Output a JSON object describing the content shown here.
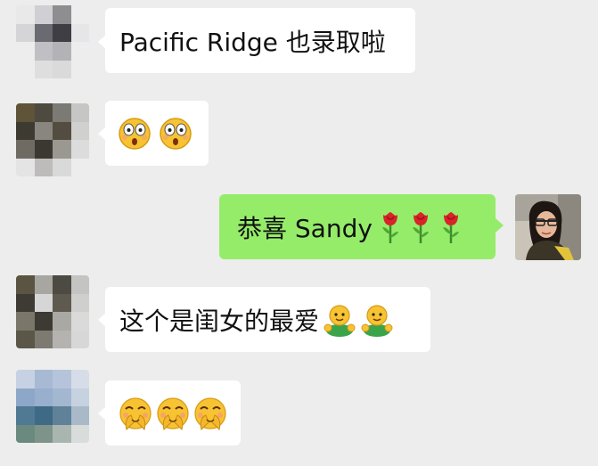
{
  "messages": {
    "m1": {
      "text": "Pacific Ridge 也录取啦"
    },
    "m2": {
      "emojis": [
        "flushed-face-icon",
        "flushed-face-icon"
      ]
    },
    "m3": {
      "text": "恭喜 Sandy",
      "emojis": [
        "rose-icon",
        "rose-icon",
        "rose-icon"
      ]
    },
    "m4": {
      "text": "这个是闺女的最爱",
      "emojis": [
        "hug-icon",
        "hug-icon"
      ]
    },
    "m5": {
      "emojis": [
        "facepalm-laugh-icon",
        "facepalm-laugh-icon",
        "facepalm-laugh-icon"
      ]
    }
  },
  "colors": {
    "background": "#ededed",
    "incoming_bubble": "#ffffff",
    "outgoing_bubble": "#95ec69",
    "text": "#111111"
  }
}
